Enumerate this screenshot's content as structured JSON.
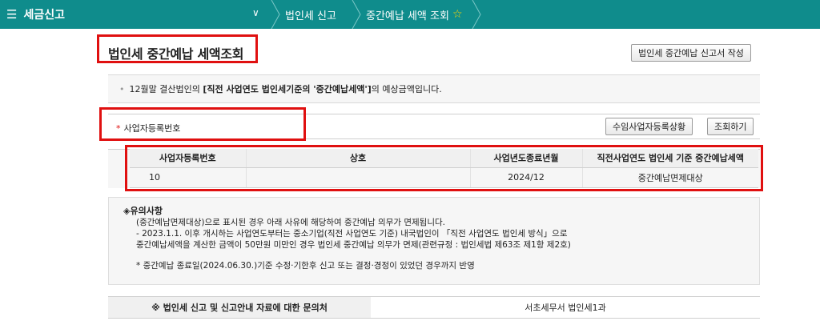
{
  "topbar": {
    "menu_icon": "☰",
    "menu_label": "세금신고",
    "chevron": "∨",
    "crumbs": [
      "법인세 신고",
      "중간예납 세액 조회"
    ],
    "star": "☆"
  },
  "page": {
    "title": "법인세 중간예납 세액조회",
    "write_button": "법인세 중간예납 신고서 작성"
  },
  "notice": {
    "prefix": "12월말 결산법인의",
    "bold": "[직전 사업연도 법인세기준의 '중간예납세액']",
    "suffix": "의 예상금액입니다."
  },
  "search": {
    "label": "사업자등록번호",
    "input_value": "",
    "btn_import": "수임사업자등록상황",
    "btn_search": "조회하기"
  },
  "table": {
    "headers": [
      "사업자등록번호",
      "상호",
      "사업년도종료년월",
      "직전사업연도 법인세 기준 중간예납세액"
    ],
    "rows": [
      [
        "10",
        "",
        "2024/12",
        "중간예납면제대상"
      ]
    ]
  },
  "caution": {
    "heading": "◈유의사항",
    "lines": [
      "(중간예납면제대상)으로 표시된 경우 아래 사유에 해당하여 중간예납 의무가 면제됩니다.",
      "- 2023.1.1. 이후 개시하는 사업연도부터는 중소기업(직전 사업연도 기준) 내국법인이 「직전 사업연도 법인세 방식」으로",
      "중간예납세액을 계산한 금액이 50만원 미만인 경우 법인세 중간예납 의무가 면제(관련규정 : 법인세법 제63조 제1항 제2호)"
    ],
    "footnote": "* 중간예납 종료일(2024.06.30.)기준 수정·기한후 신고 또는 결정·경정이 있었던 경우까지 반영"
  },
  "contact": {
    "label": "※ 법인세 신고 및 신고안내 자료에 대한 문의처",
    "value": "서초세무서 법인세1과"
  }
}
